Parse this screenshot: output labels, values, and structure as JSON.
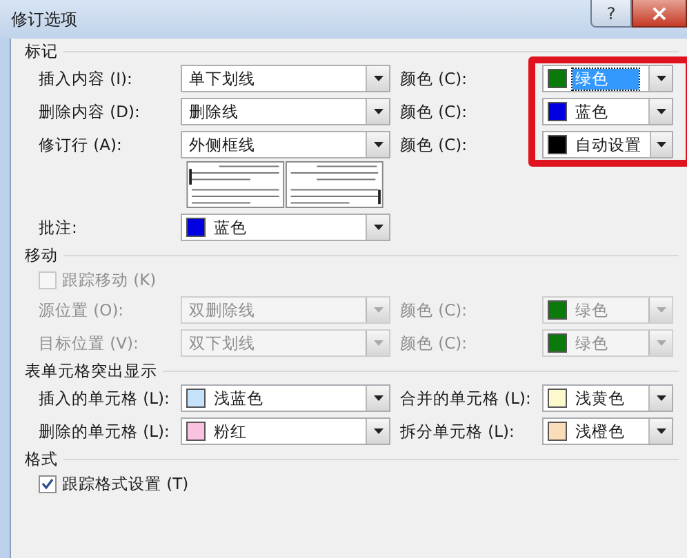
{
  "window": {
    "title": "修订选项",
    "help_button": "?",
    "close_button": "×"
  },
  "sections": [
    {
      "heading": "标记",
      "color_column_highlighted": true,
      "rows": [
        {
          "kind": "line",
          "label": "插入内容 (I):",
          "value": "单下划线",
          "disabled": false,
          "color_label": "颜色 (C):",
          "color_value": "绿色",
          "color": "#0a7a0a",
          "selected": true
        },
        {
          "kind": "line",
          "label": "删除内容 (D):",
          "value": "删除线",
          "disabled": false,
          "color_label": "颜色 (C):",
          "color_value": "蓝色",
          "color": "#0000e0",
          "selected": false
        },
        {
          "kind": "line",
          "label": "修订行 (A):",
          "value": "外侧框线",
          "disabled": false,
          "color_label": "颜色 (C):",
          "color_value": "自动设置",
          "color": "#000000",
          "selected": false
        },
        {
          "kind": "preview"
        },
        {
          "kind": "single",
          "label": "批注:",
          "value": "蓝色",
          "color": "#0000e0"
        }
      ]
    },
    {
      "heading": "移动",
      "rows": [
        {
          "kind": "checkbox",
          "label": "跟踪移动 (K)",
          "checked": false,
          "disabled": true
        },
        {
          "kind": "line",
          "label": "源位置 (O):",
          "value": "双删除线",
          "disabled": true,
          "color_label": "颜色 (C):",
          "color_value": "绿色",
          "color": "#0a7a0a",
          "selected": false
        },
        {
          "kind": "line",
          "label": "目标位置 (V):",
          "value": "双下划线",
          "disabled": true,
          "color_label": "颜色 (C):",
          "color_value": "绿色",
          "color": "#0a7a0a",
          "selected": false
        }
      ]
    },
    {
      "heading": "表单元格突出显示",
      "rows": [
        {
          "kind": "cells",
          "cells": [
            {
              "label": "插入的单元格 (L):",
              "value": "浅蓝色",
              "color": "#c6e2fb"
            },
            {
              "label": "合并的单元格 (L):",
              "value": "浅黄色",
              "color": "#fdf9cc"
            }
          ]
        },
        {
          "kind": "cells",
          "cells": [
            {
              "label": "删除的单元格 (L):",
              "value": "粉红",
              "color": "#f9c3e0"
            },
            {
              "label": "拆分单元格 (L):",
              "value": "浅橙色",
              "color": "#fbdcb8"
            }
          ]
        }
      ]
    },
    {
      "heading": "格式",
      "rows": [
        {
          "kind": "checkbox",
          "label": "跟踪格式设置 (T)",
          "checked": true,
          "disabled": false
        }
      ]
    }
  ]
}
